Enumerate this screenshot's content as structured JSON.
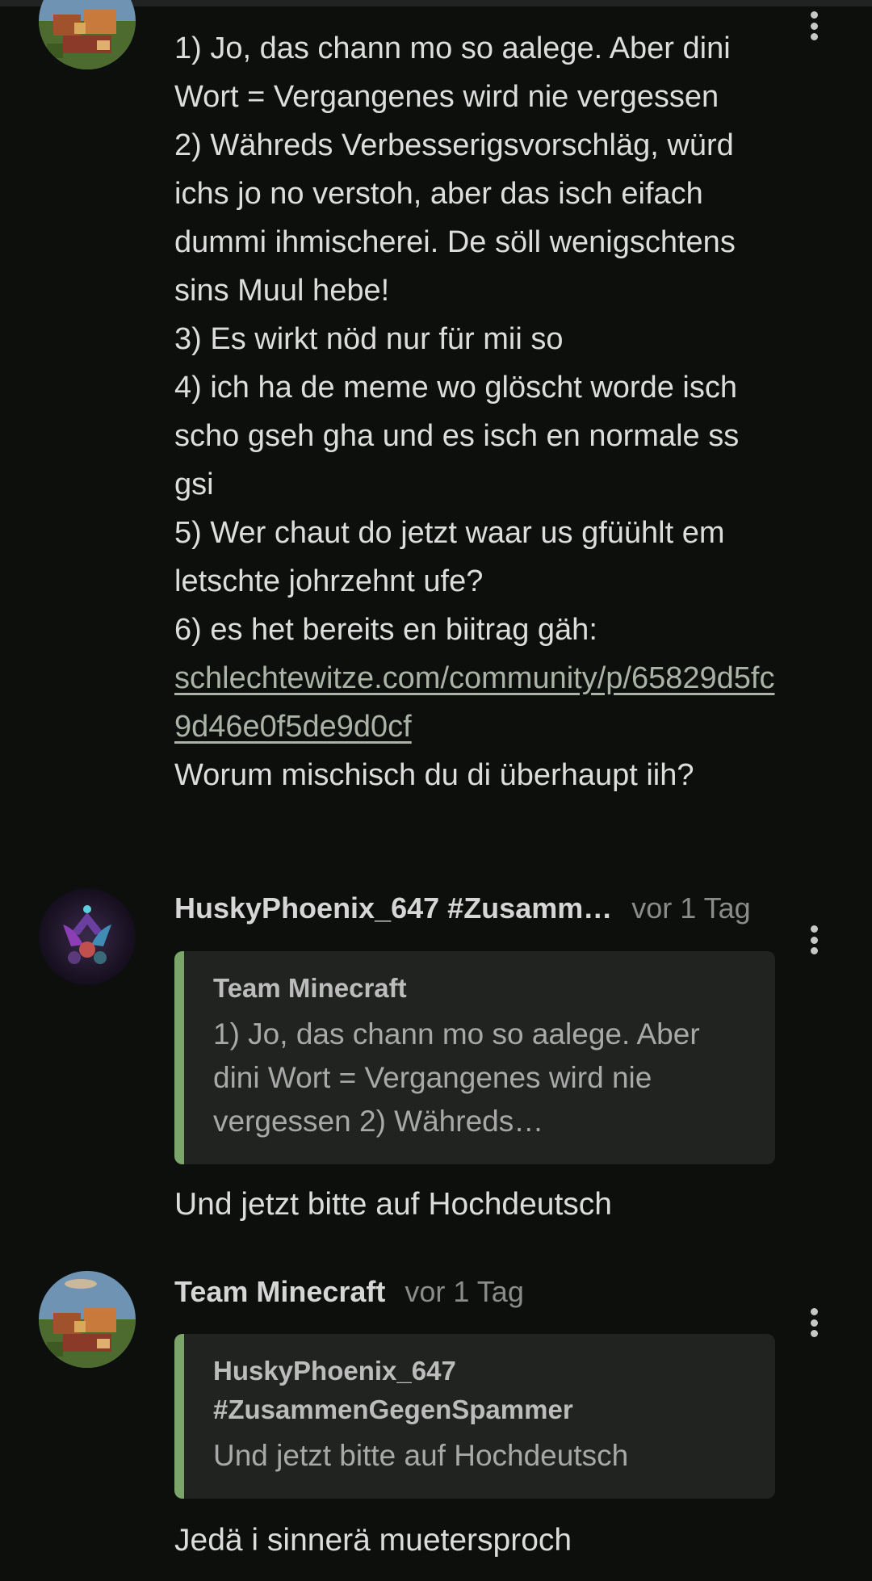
{
  "comments": [
    {
      "lines": [
        "1) Jo, das chann mo so aalege. Aber dini Wort = Vergangenes wird nie vergessen",
        "2) Währeds Verbesserigsvorschläg, würd ichs jo no verstoh, aber das isch eifach dummi ihmischerei. De söll wenigschtens sins Muul hebe!",
        "3) Es wirkt nöd nur für mii so",
        "4) ich ha de meme wo glöscht worde isch scho gseh gha und es isch en normale ss gsi",
        "5) Wer chaut do jetzt waar us gfüühlt em letschte johrzehnt ufe?",
        "6) es het bereits en biitrag gäh:"
      ],
      "link": "schlechtewitze.com/community/p/65829d5fc9d46e0f5de9d0cf",
      "closing": "Worum mischisch du di überhaupt iih?"
    },
    {
      "author": "HuskyPhoenix_647 #Zusamm…",
      "time": "vor 1 Tag",
      "quote_author": "Team Minecraft",
      "quote_text": "1) Jo, das chann mo so aalege. Aber dini Wort = Vergangenes wird nie vergessen 2) Währeds…",
      "text": "Und jetzt bitte auf Hochdeutsch"
    },
    {
      "author": "Team Minecraft",
      "time": "vor 1 Tag",
      "quote_author": "HuskyPhoenix_647 #ZusammenGegenSpammer",
      "quote_text": "Und jetzt bitte auf Hochdeutsch",
      "text": "Jedä i sinnerä muetersproch"
    }
  ],
  "icons": {
    "avatar_team_minecraft": "minecraft-village-avatar-icon",
    "avatar_husky_phoenix": "phoenix-emblem-avatar-icon",
    "menu": "more-vertical-icon"
  },
  "colors": {
    "background": "#0d0f0d",
    "quote_background": "#212321",
    "quote_accent": "#7ba56b",
    "link": "#aab3a6",
    "muted": "#8b8b8b"
  }
}
